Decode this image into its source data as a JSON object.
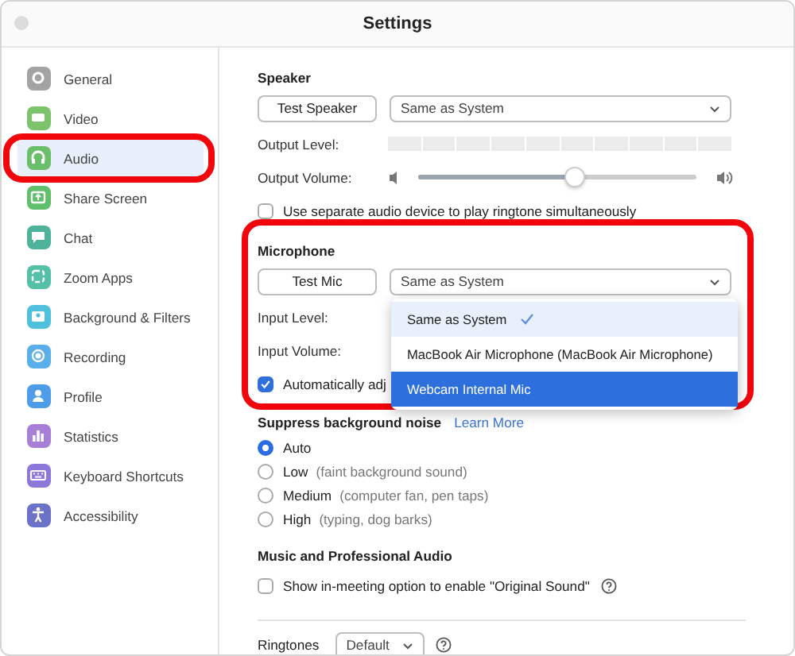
{
  "window": {
    "title": "Settings"
  },
  "sidebar": {
    "items": [
      {
        "label": "General",
        "color": "#a3a3a3",
        "selected": false
      },
      {
        "label": "Video",
        "color": "#7cc36b",
        "selected": false
      },
      {
        "label": "Audio",
        "color": "#6cbf6a",
        "selected": true
      },
      {
        "label": "Share Screen",
        "color": "#5fbf6b",
        "selected": false
      },
      {
        "label": "Chat",
        "color": "#4fb39b",
        "selected": false
      },
      {
        "label": "Zoom Apps",
        "color": "#56bfa8",
        "selected": false
      },
      {
        "label": "Background & Filters",
        "color": "#4fc1dd",
        "selected": false
      },
      {
        "label": "Recording",
        "color": "#5aaeea",
        "selected": false
      },
      {
        "label": "Profile",
        "color": "#4f9de9",
        "selected": false
      },
      {
        "label": "Statistics",
        "color": "#a77fd6",
        "selected": false
      },
      {
        "label": "Keyboard Shortcuts",
        "color": "#8b78d9",
        "selected": false
      },
      {
        "label": "Accessibility",
        "color": "#6d72c9",
        "selected": false
      }
    ]
  },
  "speaker": {
    "heading": "Speaker",
    "test_button": "Test Speaker",
    "device": "Same as System",
    "output_level": {
      "label": "Output Level:"
    },
    "output_volume": {
      "label": "Output Volume:",
      "level": 0.56
    },
    "separate_device": {
      "label": "Use separate audio device to play ringtone simultaneously",
      "checked": false
    }
  },
  "microphone": {
    "heading": "Microphone",
    "test_button": "Test Mic",
    "device": "Same as System",
    "device_menu": {
      "expanded": true,
      "items": [
        {
          "label": "Same as System",
          "checked": true,
          "selected": false
        },
        {
          "label": "MacBook Air Microphone (MacBook Air Microphone)",
          "checked": false,
          "selected": false
        },
        {
          "label": "Webcam Internal Mic",
          "checked": false,
          "selected": true
        }
      ]
    },
    "input_level": {
      "label": "Input Level:"
    },
    "input_volume": {
      "label": "Input Volume:"
    },
    "auto_adjust": {
      "label": "Automatically adj",
      "checked": true
    }
  },
  "suppress_noise": {
    "heading": "Suppress background noise",
    "link": "Learn More",
    "options": [
      {
        "label": "Auto",
        "selected": true
      },
      {
        "label": "Low",
        "hint": "(faint background sound)",
        "selected": false
      },
      {
        "label": "Medium",
        "hint": "(computer fan, pen taps)",
        "selected": false
      },
      {
        "label": "High",
        "hint": "(typing, dog barks)",
        "selected": false
      }
    ]
  },
  "music_audio": {
    "heading": "Music and Professional Audio",
    "original_sound": {
      "label": "Show in-meeting option to enable \"Original Sound\"",
      "checked": false
    }
  },
  "ringtones": {
    "label": "Ringtones",
    "value": "Default"
  }
}
